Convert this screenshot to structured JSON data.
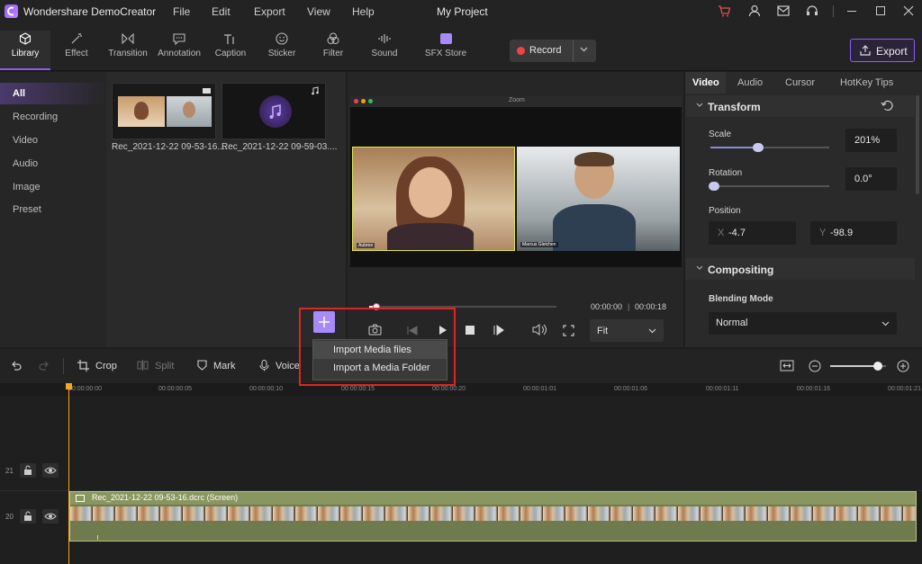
{
  "app": {
    "title": "Wondershare DemoCreator",
    "project": "My Project"
  },
  "menu": [
    "File",
    "Edit",
    "Export",
    "View",
    "Help"
  ],
  "toolbar": {
    "tools": [
      {
        "label": "Library",
        "icon": "cube-icon"
      },
      {
        "label": "Effect",
        "icon": "magic-wand-icon"
      },
      {
        "label": "Transition",
        "icon": "transition-icon"
      },
      {
        "label": "Annotation",
        "icon": "speech-bubble-icon"
      },
      {
        "label": "Caption",
        "icon": "caption-icon"
      },
      {
        "label": "Sticker",
        "icon": "smiley-icon"
      },
      {
        "label": "Filter",
        "icon": "filter-icon"
      },
      {
        "label": "Sound",
        "icon": "sound-wave-icon"
      },
      {
        "label": "SFX Store",
        "icon": "store-icon"
      }
    ],
    "record_label": "Record",
    "export_label": "Export"
  },
  "library": {
    "items": [
      "All",
      "Recording",
      "Video",
      "Audio",
      "Image",
      "Preset"
    ],
    "media": [
      {
        "name": "Rec_2021-12-22 09-53-16...."
      },
      {
        "name": "Rec_2021-12-22 09-59-03...."
      }
    ]
  },
  "preview": {
    "window_title": "Zoom",
    "participant_left": "Aubree",
    "participant_right": "Marcus Gleichen",
    "time_current": "00:00:00",
    "time_total": "00:00:18",
    "fit_label": "Fit",
    "progress": 0.02
  },
  "import_menu": {
    "items": [
      "Import Media files",
      "Import a Media Folder"
    ]
  },
  "properties": {
    "tabs": [
      "Video",
      "Audio",
      "Cursor",
      "HotKey Tips"
    ],
    "transform_title": "Transform",
    "scale_label": "Scale",
    "scale_value": "201%",
    "scale_level": 0.4,
    "rotation_label": "Rotation",
    "rotation_value": "0.0°",
    "rotation_level": 0.0,
    "position_label": "Position",
    "pos_x_label": "X",
    "pos_x": "-4.7",
    "pos_y_label": "Y",
    "pos_y": "-98.9",
    "compositing_title": "Compositing",
    "blending_label": "Blending Mode",
    "blending_value": "Normal"
  },
  "timeline": {
    "tools": [
      "Crop",
      "Split",
      "Mark",
      "Voice"
    ],
    "ticks": [
      "00:00:00:00",
      "00:00:00:05",
      "00:00:00:10",
      "00:00:00:15",
      "00:00:00:20",
      "00:00:01:01",
      "00:00:01:06",
      "00:00:01:11",
      "00:00:01:16",
      "00:00:01:21"
    ],
    "tracks": [
      "21",
      "20"
    ],
    "clip_label": "Rec_2021-12-22 09-53-16.dcrc (Screen)",
    "zoom_level": 0.85
  }
}
